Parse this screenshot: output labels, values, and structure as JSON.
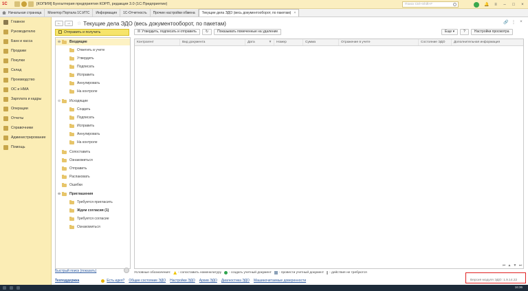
{
  "window": {
    "title": "[КОПИЯ] Бухгалтерия предприятия КОРП, редакция 3.0  (1С:Предприятие)",
    "search_placeholder": "Поиск Ctrl+Shift+F"
  },
  "tabs": [
    {
      "label": "Начальная страница"
    },
    {
      "label": "Монитор Портала 1С:ИТС"
    },
    {
      "label": "Информация"
    },
    {
      "label": "1С-Отчетность"
    },
    {
      "label": "Прочие настройки обмена"
    },
    {
      "label": "Текущие дела ЭДО (весь документооборот, по пакетам)",
      "active": true,
      "close": "×"
    }
  ],
  "sections": [
    {
      "label": "Главное"
    },
    {
      "label": "Руководителю"
    },
    {
      "label": "Банк и касса"
    },
    {
      "label": "Продажи"
    },
    {
      "label": "Покупки"
    },
    {
      "label": "Склад"
    },
    {
      "label": "Производство"
    },
    {
      "label": "ОС и НМА"
    },
    {
      "label": "Зарплата и кадры"
    },
    {
      "label": "Операции"
    },
    {
      "label": "Отчеты"
    },
    {
      "label": "Справочники"
    },
    {
      "label": "Администрирование"
    },
    {
      "label": "Помощь"
    }
  ],
  "page": {
    "nav_back": "←",
    "nav_forward": "→",
    "star": "☆",
    "title": "Текущие дела ЭДО (весь документооборот, по пакетам)",
    "hdr_link": "🔗",
    "hdr_more": "⋮",
    "hdr_close": "×"
  },
  "send_button": "Отправить и получить",
  "tree": [
    {
      "label": "Входящие",
      "level": 0,
      "toggle": "⊖",
      "bold": true,
      "selected": true
    },
    {
      "label": "Ответить в учете",
      "level": 1
    },
    {
      "label": "Утвердить",
      "level": 1
    },
    {
      "label": "Подписать",
      "level": 1
    },
    {
      "label": "Исправить",
      "level": 1
    },
    {
      "label": "Аннулировать",
      "level": 1
    },
    {
      "label": "На контроле",
      "level": 1
    },
    {
      "label": "Исходящие",
      "level": 0,
      "toggle": "⊖"
    },
    {
      "label": "Создать",
      "level": 1
    },
    {
      "label": "Подписать",
      "level": 1
    },
    {
      "label": "Исправить",
      "level": 1
    },
    {
      "label": "Аннулировать",
      "level": 1
    },
    {
      "label": "На контроле",
      "level": 1
    },
    {
      "label": "Сопоставить",
      "level": 0
    },
    {
      "label": "Ознакомиться",
      "level": 0
    },
    {
      "label": "Отправить",
      "level": 0
    },
    {
      "label": "Распаковать",
      "level": 0
    },
    {
      "label": "Ошибки",
      "level": 0
    },
    {
      "label": "Приглашения",
      "level": 0,
      "toggle": "⊖",
      "bold": true
    },
    {
      "label": "Требуется пригласить",
      "level": 1
    },
    {
      "label": "Ждем согласия (1)",
      "level": 1,
      "bold": true
    },
    {
      "label": "Требуется согласие",
      "level": 1
    },
    {
      "label": "Ознакомиться",
      "level": 1
    }
  ],
  "toolbar": {
    "approve_sign_send": "Утвердить, подписать и отправить",
    "refresh": "↻",
    "show_deleted": "Показывать помеченные на удаление",
    "more": "Еще ▾",
    "help": "?",
    "view_settings": "Настройки просмотра"
  },
  "table": {
    "columns": [
      "Контрагент",
      "Вид документа",
      "Дата",
      "Номер",
      "Сумма",
      "Отражение в учете",
      "Состояние ЭДО",
      "Дополнительная информация"
    ],
    "sort_indicator": "▼",
    "rows": [],
    "scroll_first": "⏮",
    "scroll_up": "▲",
    "scroll_down": "▼",
    "scroll_last": "⏭"
  },
  "legend": {
    "label": "Условные обозначения:",
    "items": [
      "- сопоставить номенклатуру",
      "- создать учетный документ",
      "- провести учетный документ",
      "- действия не требуются"
    ]
  },
  "quick_search": "Быстрый поиск (показать)",
  "bottom": {
    "tech_support": "Техподдержка",
    "links": [
      "Есть идея?",
      "Общие состояние ЭДО",
      "Настройки ЭДО",
      "Архив ЭДО",
      "Диагностика ЭДО",
      "Машиночитаемые доверенности"
    ]
  },
  "version": "Версия модуля ЭДО: 1.9.14.22",
  "taskbar": {
    "clock": "16:36"
  },
  "colors": {
    "accent": "#f6e46b",
    "panel": "#fbedb5",
    "link": "#2c5aa0",
    "highlight_box": "#e02020"
  }
}
